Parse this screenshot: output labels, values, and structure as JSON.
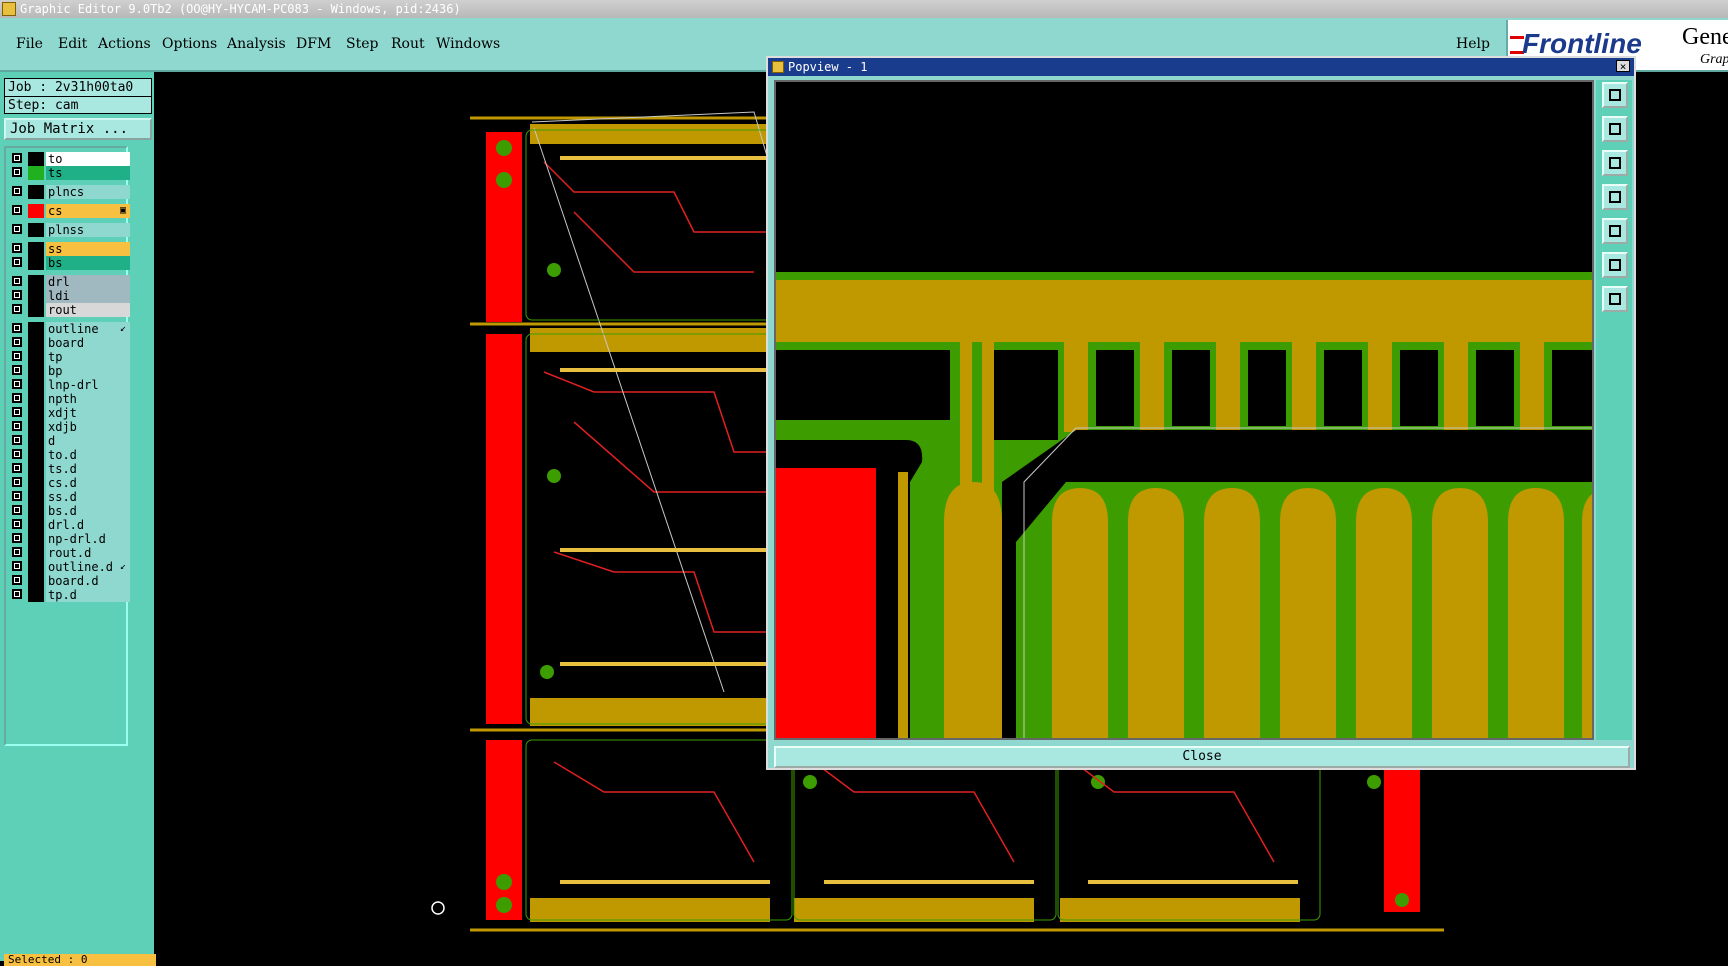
{
  "window": {
    "title": "Graphic Editor 9.0Tb2 (OO@HY-HYCAM-PC083 - Windows, pid:2436)"
  },
  "menu": {
    "items": [
      "File",
      "Edit",
      "Actions",
      "Options",
      "Analysis",
      "DFM",
      "Step",
      "Rout",
      "Windows"
    ],
    "help": "Help"
  },
  "logo": {
    "brand": "Frontline",
    "gene": "Gene",
    "grap": "Grap"
  },
  "job": {
    "job_line": "Job : 2v31h00ta0",
    "step_line": "Step: cam",
    "matrix_button": "Job Matrix ..."
  },
  "layers": [
    {
      "name": "to",
      "color": "#ffffff",
      "swatch": "#000000"
    },
    {
      "name": "ts",
      "color": "#20b088",
      "swatch": "#20b020"
    },
    {
      "name": "plncs",
      "color": "#8fd8d0",
      "swatch": "#000000"
    },
    {
      "name": "cs",
      "color": "#f8c040",
      "swatch": "#ff0000",
      "mark": "▣"
    },
    {
      "name": "plnss",
      "color": "#8fd8d0",
      "swatch": "#000000"
    },
    {
      "name": "ss",
      "color": "#f8c040",
      "swatch": "#000000"
    },
    {
      "name": "bs",
      "color": "#20b088",
      "swatch": "#000000"
    },
    {
      "name": "drl",
      "color": "#a0b8c0",
      "swatch": "#000000"
    },
    {
      "name": "ldi",
      "color": "#a0b8c0",
      "swatch": "#000000"
    },
    {
      "name": "rout",
      "color": "#d8d8d8",
      "swatch": "#000000"
    },
    {
      "name": "outline",
      "color": "#8fd8d0",
      "swatch": "#000000",
      "mark": "↙"
    },
    {
      "name": "board",
      "color": "#8fd8d0",
      "swatch": "#000000"
    },
    {
      "name": "tp",
      "color": "#8fd8d0",
      "swatch": "#000000"
    },
    {
      "name": "bp",
      "color": "#8fd8d0",
      "swatch": "#000000"
    },
    {
      "name": "lnp-drl",
      "color": "#8fd8d0",
      "swatch": "#000000"
    },
    {
      "name": "npth",
      "color": "#8fd8d0",
      "swatch": "#000000"
    },
    {
      "name": "xdjt",
      "color": "#8fd8d0",
      "swatch": "#000000"
    },
    {
      "name": "xdjb",
      "color": "#8fd8d0",
      "swatch": "#000000"
    },
    {
      "name": "d",
      "color": "#8fd8d0",
      "swatch": "#000000"
    },
    {
      "name": "to.d",
      "color": "#8fd8d0",
      "swatch": "#000000"
    },
    {
      "name": "ts.d",
      "color": "#8fd8d0",
      "swatch": "#000000"
    },
    {
      "name": "cs.d",
      "color": "#8fd8d0",
      "swatch": "#000000"
    },
    {
      "name": "ss.d",
      "color": "#8fd8d0",
      "swatch": "#000000"
    },
    {
      "name": "bs.d",
      "color": "#8fd8d0",
      "swatch": "#000000"
    },
    {
      "name": "drl.d",
      "color": "#8fd8d0",
      "swatch": "#000000"
    },
    {
      "name": "np-drl.d",
      "color": "#8fd8d0",
      "swatch": "#000000"
    },
    {
      "name": "rout.d",
      "color": "#8fd8d0",
      "swatch": "#000000"
    },
    {
      "name": "outline.d",
      "color": "#8fd8d0",
      "swatch": "#000000",
      "mark": "↙"
    },
    {
      "name": "board.d",
      "color": "#8fd8d0",
      "swatch": "#000000"
    },
    {
      "name": "tp.d",
      "color": "#8fd8d0",
      "swatch": "#000000"
    }
  ],
  "status": {
    "selected": "Selected : 0"
  },
  "popview": {
    "title": "Popview - 1",
    "close_label": "Close",
    "close_x": "×"
  },
  "colors": {
    "copper": "#c09800",
    "mask": "#3c9c00",
    "pad": "#ff0000",
    "trace": "#e02020"
  }
}
